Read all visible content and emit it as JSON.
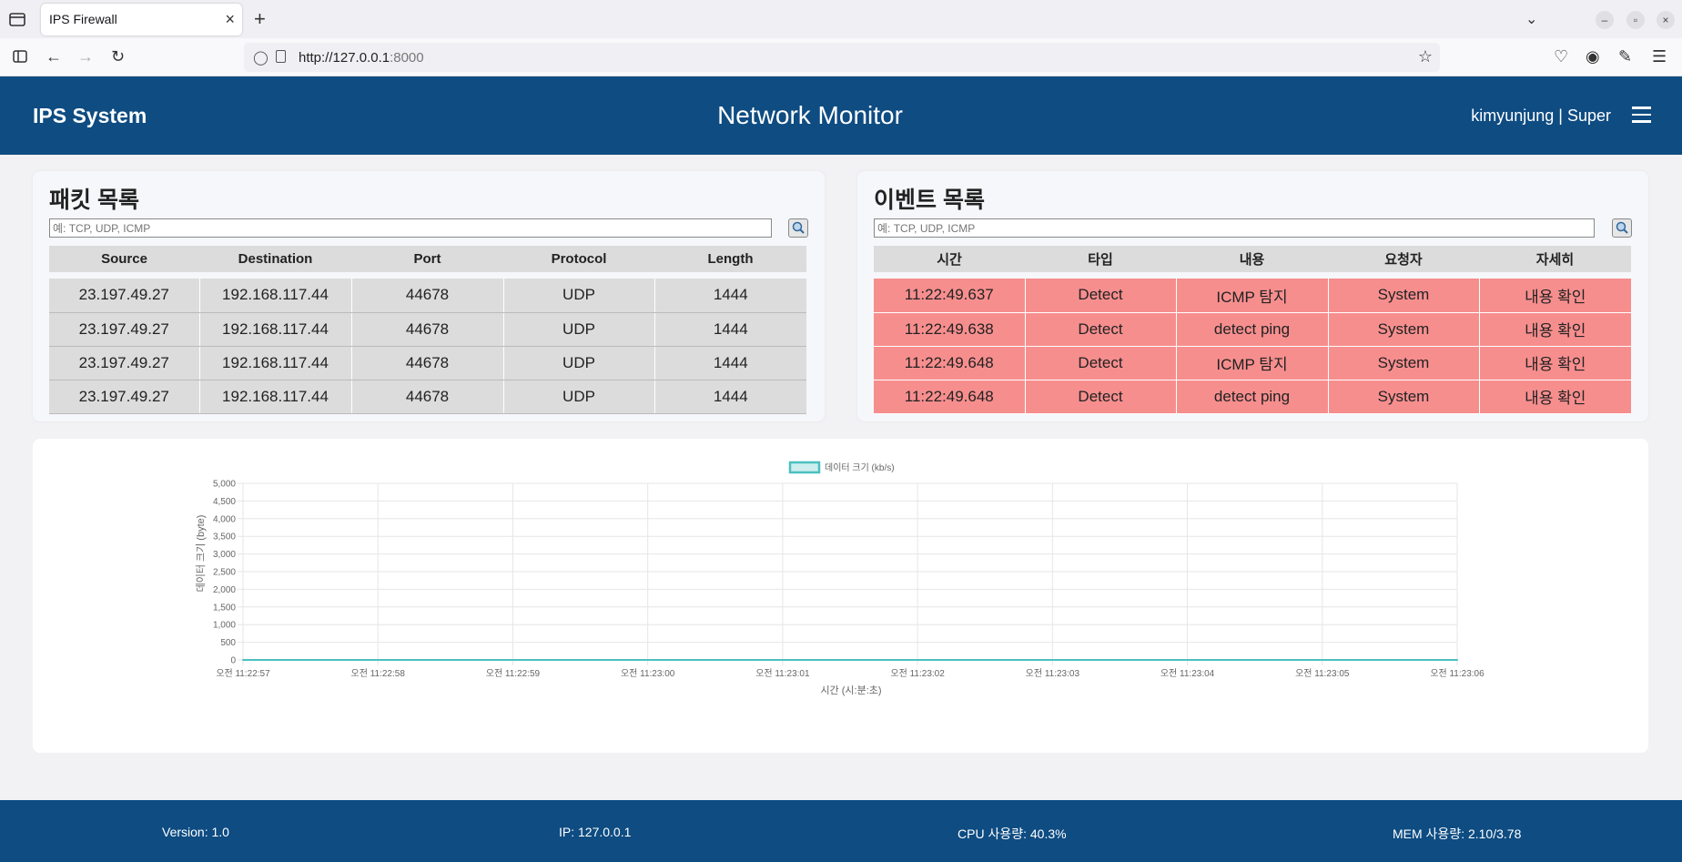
{
  "browser": {
    "tab_title": "IPS Firewall",
    "tab_close": "×",
    "new_tab": "+",
    "url_host": "http://127.0.0.1",
    "url_port": ":8000",
    "icons": [
      "tab-list-icon",
      "sidebar-icon",
      "back-icon",
      "forward-icon",
      "reload-icon",
      "shield-icon",
      "page-icon",
      "star-icon",
      "pocket-icon",
      "account-icon",
      "extensions-icon",
      "hamburger-icon"
    ]
  },
  "header": {
    "brand": "IPS System",
    "title": "Network Monitor",
    "user": "kimyunjung | Super",
    "color": "#0e4c82"
  },
  "packets": {
    "title": "패킷 목록",
    "search_placeholder": "예: TCP, UDP, ICMP",
    "columns": [
      "Source",
      "Destination",
      "Port",
      "Protocol",
      "Length"
    ],
    "rows": [
      [
        "23.197.49.27",
        "192.168.117.44",
        "44678",
        "UDP",
        "1444"
      ],
      [
        "23.197.49.27",
        "192.168.117.44",
        "44678",
        "UDP",
        "1444"
      ],
      [
        "23.197.49.27",
        "192.168.117.44",
        "44678",
        "UDP",
        "1444"
      ],
      [
        "23.197.49.27",
        "192.168.117.44",
        "44678",
        "UDP",
        "1444"
      ]
    ]
  },
  "events": {
    "title": "이벤트 목록",
    "search_placeholder": "예: TCP, UDP, ICMP",
    "columns": [
      "시간",
      "타입",
      "내용",
      "요청자",
      "자세히"
    ],
    "row_color": "#f78e8e",
    "rows": [
      [
        "11:22:49.637",
        "Detect",
        "ICMP 탐지",
        "System",
        "내용 확인"
      ],
      [
        "11:22:49.638",
        "Detect",
        "detect ping",
        "System",
        "내용 확인"
      ],
      [
        "11:22:49.648",
        "Detect",
        "ICMP 탐지",
        "System",
        "내용 확인"
      ],
      [
        "11:22:49.648",
        "Detect",
        "detect ping",
        "System",
        "내용 확인"
      ]
    ]
  },
  "chart_data": {
    "type": "line",
    "legend": "데이터 크기 (kb/s)",
    "legend_position": "top",
    "xlabel": "시간 (시:분:초)",
    "ylabel": "데이터 크기 (byte)",
    "ylim": [
      0,
      5000
    ],
    "y_ticks": [
      "5,000",
      "4,500",
      "4,000",
      "3,500",
      "3,000",
      "2,500",
      "2,000",
      "1,500",
      "1,000",
      "500",
      "0"
    ],
    "categories": [
      "오전 11:22:57",
      "오전 11:22:58",
      "오전 11:22:59",
      "오전 11:23:00",
      "오전 11:23:01",
      "오전 11:23:02",
      "오전 11:23:03",
      "오전 11:23:04",
      "오전 11:23:05",
      "오전 11:23:06"
    ],
    "series": [
      {
        "name": "데이터 크기 (kb/s)",
        "values": [
          0,
          0,
          0,
          0,
          0,
          0,
          0,
          0,
          0,
          0
        ],
        "color": "#4bc0c0"
      }
    ],
    "grid": true
  },
  "footer": {
    "version": "Version: 1.0",
    "ip": "IP: 127.0.0.1",
    "cpu": "CPU 사용량: 40.3%",
    "mem": "MEM 사용량: 2.10/3.78"
  }
}
